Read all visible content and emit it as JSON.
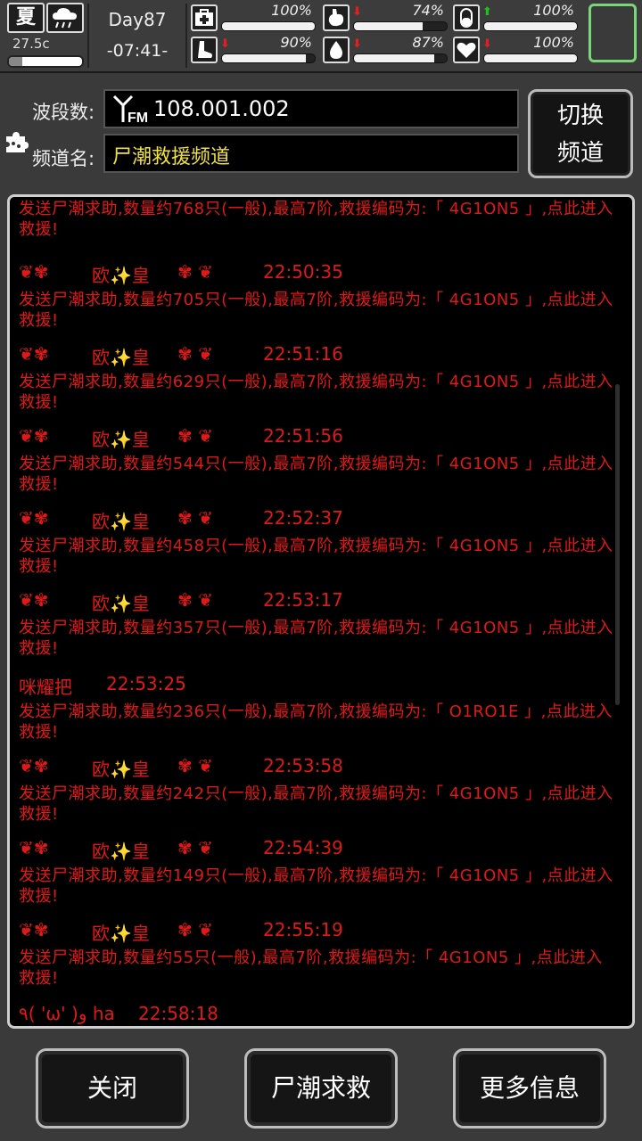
{
  "status": {
    "season": "夏",
    "temperature": "27.5c",
    "temperature_level": 0.18,
    "day": "Day87",
    "clock": "-07:41-",
    "stats": [
      {
        "icon": "medkit-icon",
        "trend": "",
        "value": "100%",
        "level": 1.0
      },
      {
        "icon": "stomach-icon",
        "trend": "down",
        "value": "74%",
        "level": 0.74
      },
      {
        "icon": "pill-icon",
        "trend": "up",
        "value": "100%",
        "level": 1.0
      },
      {
        "icon": "foot-icon",
        "trend": "down",
        "value": "90%",
        "level": 0.9
      },
      {
        "icon": "water-drop-icon",
        "trend": "down",
        "value": "87%",
        "level": 0.87
      },
      {
        "icon": "heart-icon",
        "trend": "down",
        "value": "100%",
        "level": 1.0
      }
    ]
  },
  "radio": {
    "band_label": "波段数:",
    "band_value": "108.001.002",
    "channel_label": "频道名:",
    "channel_value": "尸潮救援频道",
    "switch_line1": "切换",
    "switch_line2": "频道"
  },
  "messages": [
    {
      "sender": "",
      "time": "",
      "body": "发送尸潮求助,数量约768只(一般),最高7阶,救援编码为:「 4G1ON5 」,点此进入救援!"
    },
    {
      "sender": "欧✨皇",
      "time": "22:50:35",
      "body": "发送尸潮求助,数量约705只(一般),最高7阶,救援编码为:「 4G1ON5 」,点此进入救援!"
    },
    {
      "sender": "欧✨皇",
      "time": "22:51:16",
      "body": "发送尸潮求助,数量约629只(一般),最高7阶,救援编码为:「 4G1ON5 」,点此进入救援!"
    },
    {
      "sender": "欧✨皇",
      "time": "22:51:56",
      "body": "发送尸潮求助,数量约544只(一般),最高7阶,救援编码为:「 4G1ON5 」,点此进入救援!"
    },
    {
      "sender": "欧✨皇",
      "time": "22:52:37",
      "body": "发送尸潮求助,数量约458只(一般),最高7阶,救援编码为:「 4G1ON5 」,点此进入救援!"
    },
    {
      "sender": "欧✨皇",
      "time": "22:53:17",
      "body": "发送尸潮求助,数量约357只(一般),最高7阶,救援编码为:「 4G1ON5 」,点此进入救援!"
    },
    {
      "sender": "咪耀把",
      "time": "22:53:25",
      "body": "发送尸潮求助,数量约236只(一般),最高7阶,救援编码为:「 O1RO1E 」,点此进入救援!"
    },
    {
      "sender": "欧✨皇",
      "time": "22:53:58",
      "body": "发送尸潮求助,数量约242只(一般),最高7阶,救援编码为:「 4G1ON5 」,点此进入救援!"
    },
    {
      "sender": "欧✨皇",
      "time": "22:54:39",
      "body": "发送尸潮求助,数量约149只(一般),最高7阶,救援编码为:「 4G1ON5 」,点此进入救援!"
    },
    {
      "sender": "欧✨皇",
      "time": "22:55:19",
      "body": "发送尸潮求助,数量约55只(一般),最高7阶,救援编码为:「 4G1ON5 」,点此进入救援!"
    },
    {
      "sender": "٩( 'ω' )و ha",
      "time": "22:58:18",
      "body": ""
    }
  ],
  "buttons": {
    "close": "关闭",
    "rescue": "尸潮求救",
    "more": "更多信息"
  },
  "colors": {
    "message_text": "#e01818",
    "channel_name": "#f0e040",
    "badge_border": "#7bd67b"
  }
}
